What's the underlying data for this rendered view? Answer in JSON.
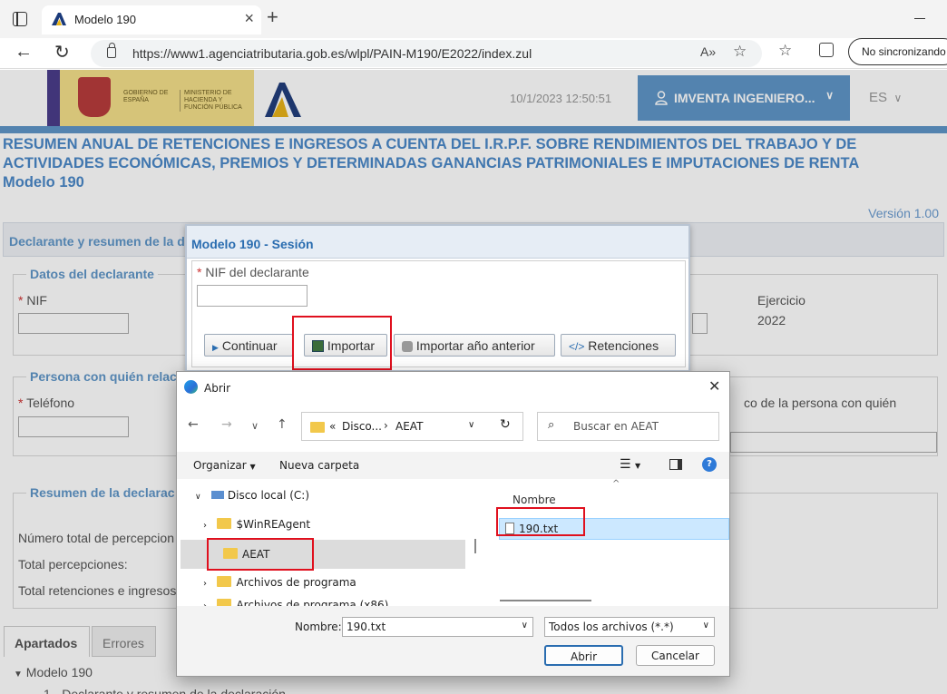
{
  "browser": {
    "tab_title": "Modelo 190",
    "url": "https://www1.agenciatributaria.gob.es/wlpl/PAIN-M190/E2022/index.zul",
    "sync_label": "No sincronizando"
  },
  "header": {
    "gov_text_1": "GOBIERNO DE ESPAÑA",
    "gov_text_2": "MINISTERIO DE HACIENDA Y FUNCIÓN PÚBLICA",
    "datetime": "10/1/2023 12:50:51",
    "user_name": "IMVENTA INGENIERO...",
    "language": "ES"
  },
  "page": {
    "title_line1": "RESUMEN ANUAL DE RETENCIONES E INGRESOS A CUENTA DEL I.R.P.F. SOBRE RENDIMIENTOS DEL TRABAJO Y DE",
    "title_line2": "ACTIVIDADES ECONÓMICAS, PREMIOS Y DETERMINADAS GANANCIAS PATRIMONIALES E IMPUTACIONES DE RENTA",
    "title_line3": "Modelo 190",
    "version": "Versión 1.00",
    "section_bar": "Declarante y resumen de la d",
    "declarante": {
      "legend": "Datos del declarante",
      "nif_label": "NIF",
      "ejercicio_label": "Ejercicio",
      "ejercicio_value": "2022"
    },
    "persona": {
      "legend": "Persona con quién relac",
      "telefono_label": "Teléfono",
      "right_label": "co de la persona con quién"
    },
    "resumen": {
      "legend": "Resumen de la declarac",
      "row1": "Número total de percepcion",
      "row2": "Total percepciones:",
      "row3": "Total retenciones e ingresos"
    },
    "tabs": [
      "Apartados",
      "Errores"
    ],
    "tree_root": "Modelo 190",
    "tree_child": "1 - Declarante y resumen de la declaración"
  },
  "sesion": {
    "title": "Modelo 190 - Sesión",
    "nif_label": "NIF del declarante",
    "btn_continuar": "Continuar",
    "btn_importar": "Importar",
    "btn_importar_anterior": "Importar año anterior",
    "btn_retenciones": "Retenciones"
  },
  "file_dialog": {
    "title": "Abrir",
    "path_prefix": "«",
    "path_part1": "Disco...",
    "path_part2": "AEAT",
    "search_placeholder": "Buscar en AEAT",
    "organize": "Organizar",
    "new_folder": "Nueva carpeta",
    "tree": [
      {
        "label": "Disco local (C:)"
      },
      {
        "label": "$WinREAgent"
      },
      {
        "label": "AEAT"
      },
      {
        "label": "Archivos de programa"
      },
      {
        "label": "Archivos de programa (x86)"
      }
    ],
    "column_name": "Nombre",
    "file": "190.txt",
    "name_label": "Nombre:",
    "name_value": "190.txt",
    "filter_value": "Todos los archivos (*.*)",
    "open_button": "Abrir",
    "cancel_button": "Cancelar"
  },
  "colors": {
    "accent": "#5f96c8",
    "highlight_red": "#e0101e"
  }
}
